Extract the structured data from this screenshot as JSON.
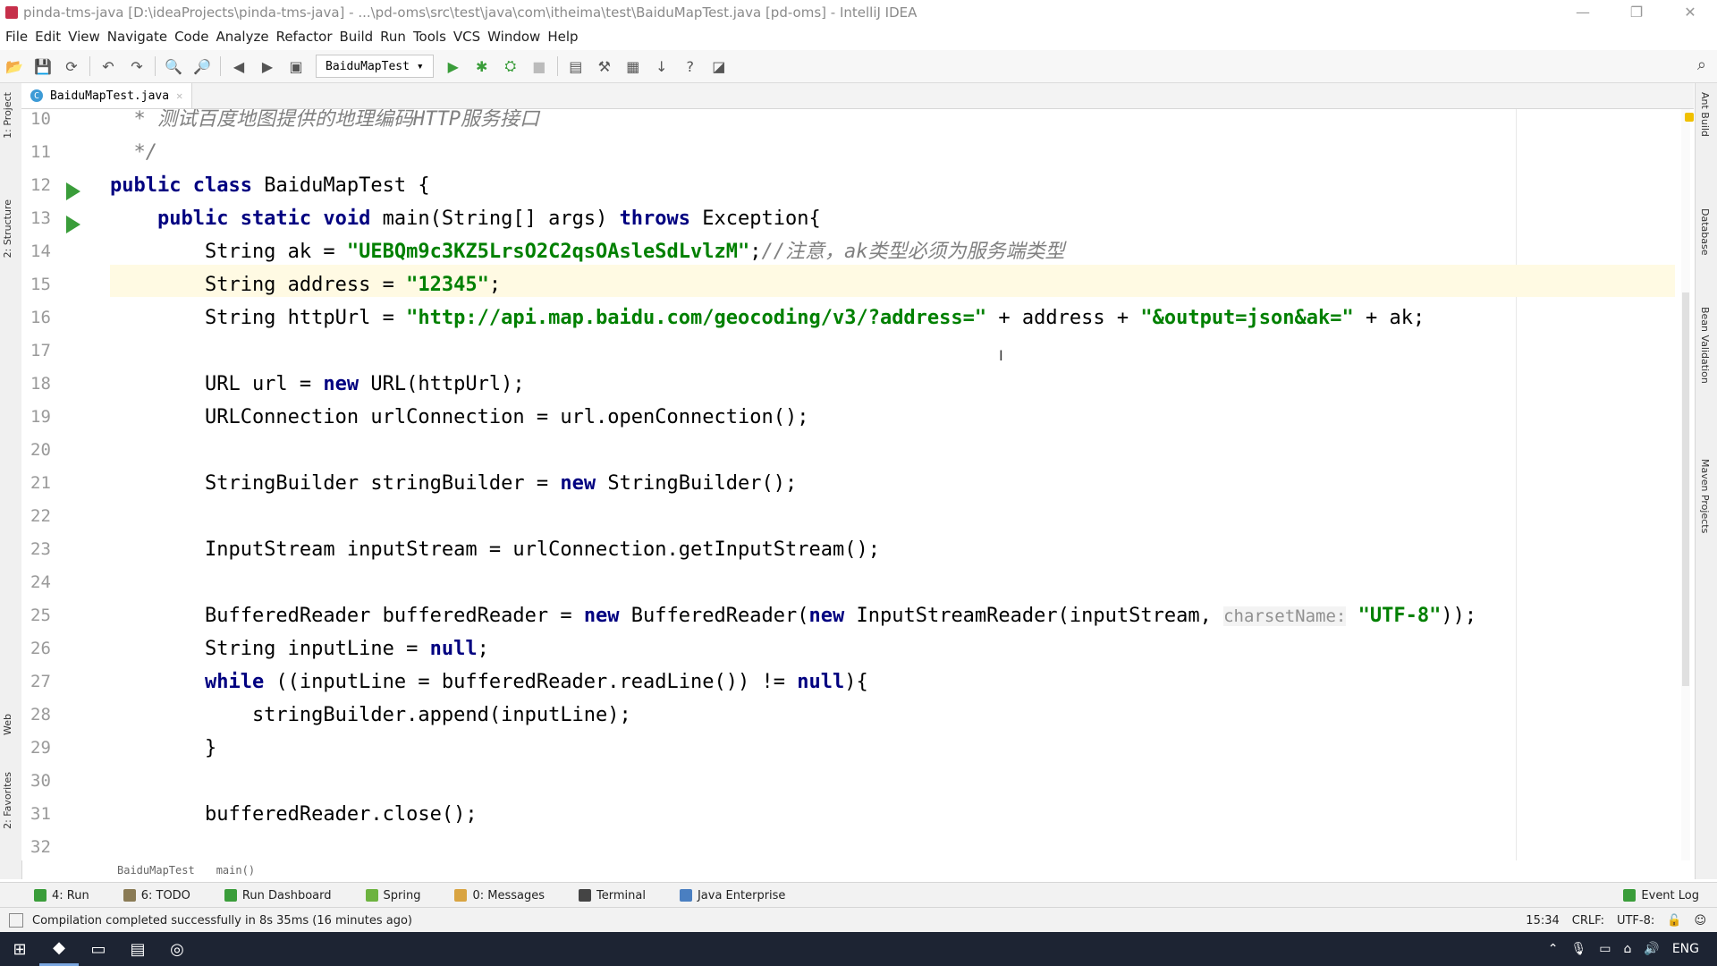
{
  "titlebar": {
    "title": "pinda-tms-java [D:\\ideaProjects\\pinda-tms-java] - ...\\pd-oms\\src\\test\\java\\com\\itheima\\test\\BaiduMapTest.java [pd-oms] - IntelliJ IDEA",
    "min": "—",
    "max": "❐",
    "close": "✕"
  },
  "menu": [
    "File",
    "Edit",
    "View",
    "Navigate",
    "Code",
    "Analyze",
    "Refactor",
    "Build",
    "Run",
    "Tools",
    "VCS",
    "Window",
    "Help"
  ],
  "toolbar": {
    "run_config": "BaiduMapTest"
  },
  "tab": {
    "label": "BaiduMapTest.java"
  },
  "left_tools": [
    "1: Project",
    "2: Structure",
    "Web",
    "2: Favorites"
  ],
  "right_tools": [
    "Ant Build",
    "Database",
    "Bean Validation",
    "Maven Projects"
  ],
  "editor": {
    "line_numbers": [
      "10",
      "11",
      "12",
      "13",
      "14",
      "15",
      "16",
      "17",
      "18",
      "19",
      "20",
      "21",
      "22",
      "23",
      "24",
      "25",
      "26",
      "27",
      "28",
      "29",
      "30",
      "31",
      "32"
    ],
    "l10_comment": "  * 测试百度地图提供的地理编码HTTP服务接口",
    "l11_comment": "  */",
    "l12_kw": "public class",
    "l12_name": " BaiduMapTest {",
    "l13_kw": "    public static void",
    "l13_mid": " main(String[] args) ",
    "l13_kw2": "throws",
    "l13_end": " Exception{",
    "l14_pre": "        String ak = ",
    "l14_str": "\"UEBQm9c3KZ5LrsO2C2qsOAsleSdLvlzM\"",
    "l14_semi": ";",
    "l14_cmt": "//注意，ak类型必须为服务端类型",
    "l15_pre": "        String address = ",
    "l15_str": "\"12345\"",
    "l15_semi": ";",
    "l16_pre": "        String httpUrl = ",
    "l16_str1": "\"http://api.map.baidu.com/geocoding/v3/?address=\"",
    "l16_mid": " + address + ",
    "l16_str2": "\"&output=json&ak=\"",
    "l16_end": " + ak;",
    "l18_pre": "        URL url = ",
    "l18_kw": "new",
    "l18_end": " URL(httpUrl);",
    "l19": "        URLConnection urlConnection = url.openConnection();",
    "l21_pre": "        StringBuilder stringBuilder = ",
    "l21_kw": "new",
    "l21_end": " StringBuilder();",
    "l23": "        InputStream inputStream = urlConnection.getInputStream();",
    "l25_pre": "        BufferedReader bufferedReader = ",
    "l25_kw1": "new",
    "l25_mid": " BufferedReader(",
    "l25_kw2": "new",
    "l25_mid2": " InputStreamReader(inputStream, ",
    "l25_hint": "charsetName:",
    "l25_sp": " ",
    "l25_str": "\"UTF-8\"",
    "l25_end": "));",
    "l26_pre": "        String inputLine = ",
    "l26_null": "null",
    "l26_semi": ";",
    "l27_kw": "        while",
    "l27_mid": " ((inputLine = bufferedReader.readLine()) != ",
    "l27_null": "null",
    "l27_end": "){",
    "l28": "            stringBuilder.append(inputLine);",
    "l29": "        }",
    "l31": "        bufferedReader.close();"
  },
  "breadcrumb": [
    "BaiduMapTest",
    "main()"
  ],
  "toolwindows": [
    "4: Run",
    "6: TODO",
    "Run Dashboard",
    "Spring",
    "0: Messages",
    "Terminal",
    "Java Enterprise"
  ],
  "event_log": "Event Log",
  "status": {
    "message": "Compilation completed successfully in 8s 35ms (16 minutes ago)",
    "position": "15:34",
    "line_sep": "CRLF:",
    "encoding": "UTF-8:"
  },
  "taskbar": {
    "lang": "ENG"
  },
  "colors": {
    "keyword": "#000080",
    "string": "#008000",
    "comment": "#808080",
    "run_arrow": "#3a9d3a"
  }
}
